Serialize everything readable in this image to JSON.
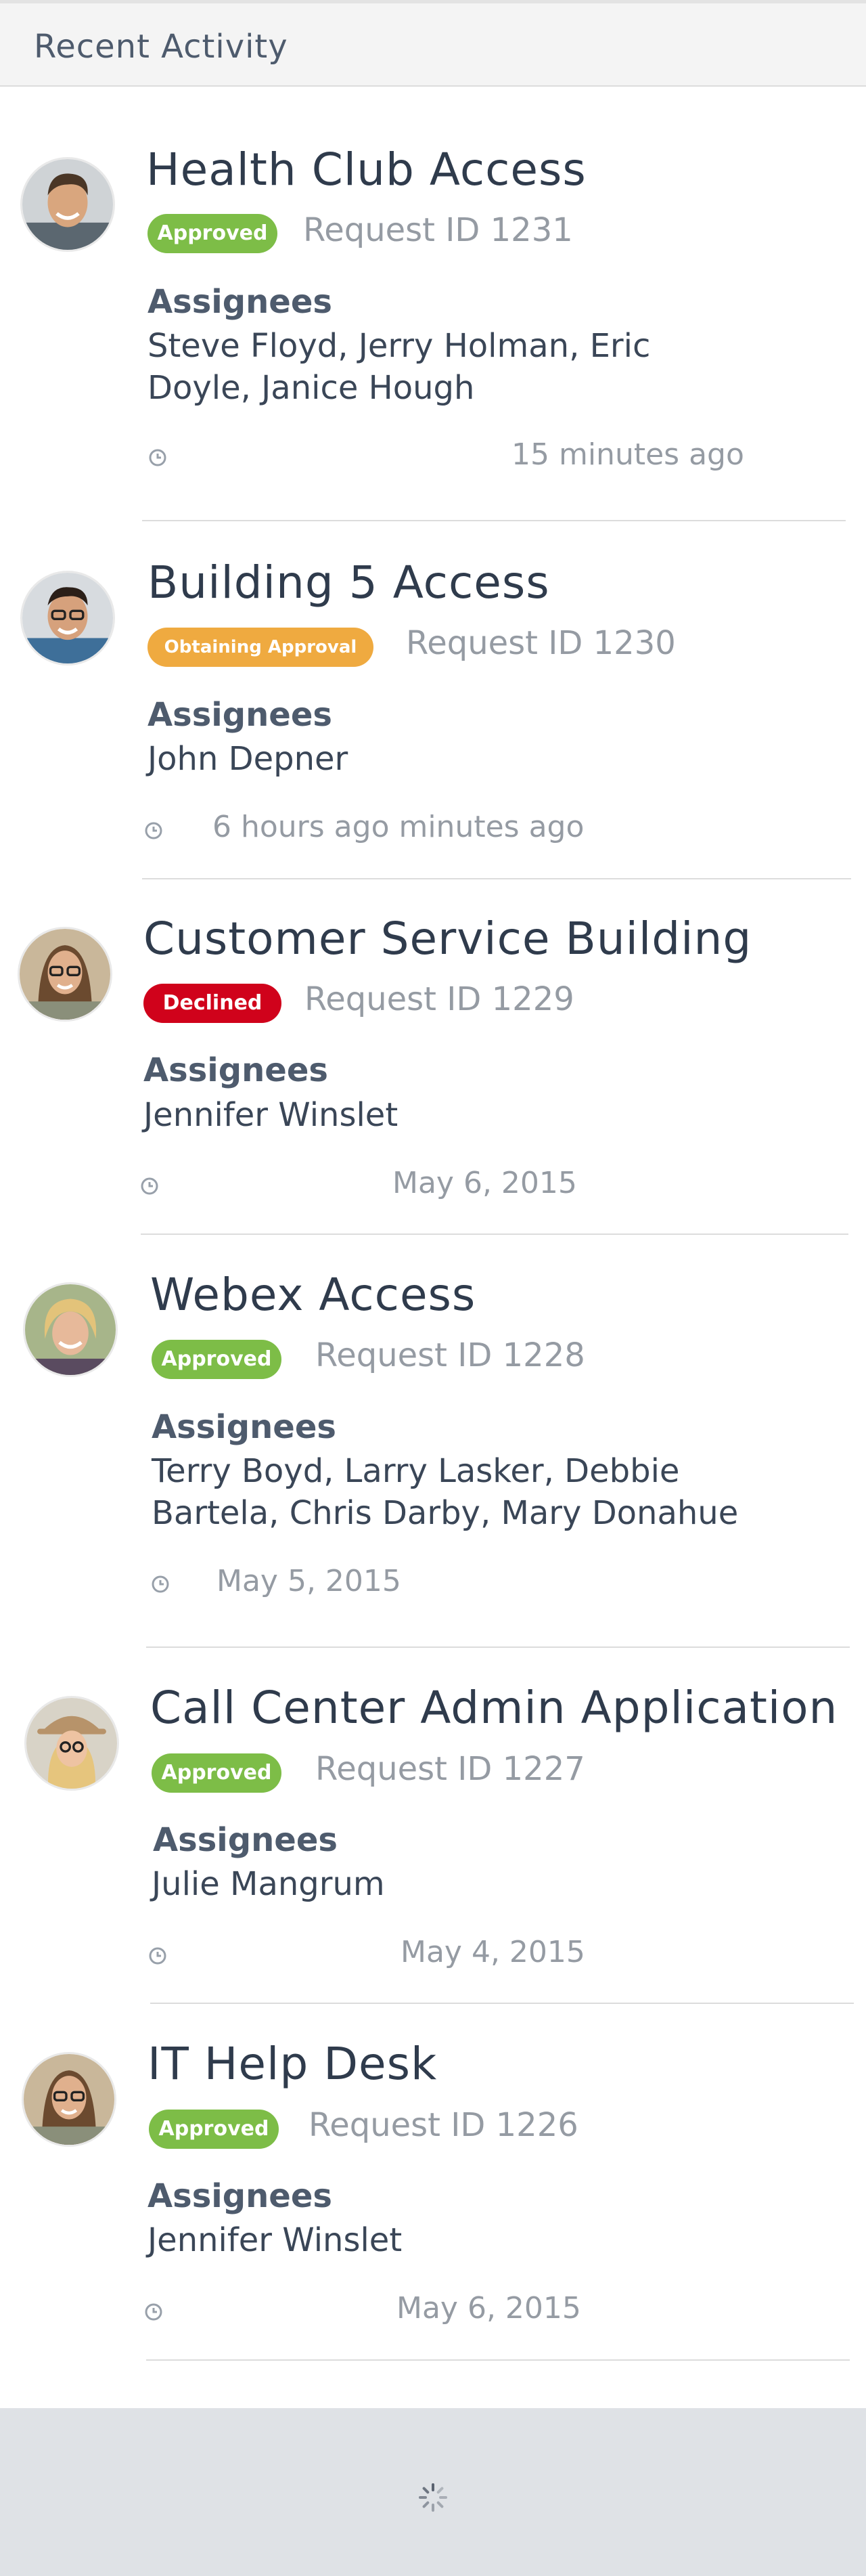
{
  "header": {
    "title": "Recent Activity"
  },
  "icons": {
    "clock": "clock-icon",
    "loading": "loading-spinner-icon"
  },
  "colors": {
    "approved": "#7dbd47",
    "obtaining_approval": "#efaa40",
    "declined": "#d0021b",
    "footer_bg": "#dfe2e6"
  },
  "assignees_label": "Assignees",
  "activities": [
    {
      "title": "Health Club Access",
      "status": "Approved",
      "request_id": "Request ID 1231",
      "assignees": "Steve Floyd, Jerry Holman, Eric Doyle, Janice Hough",
      "time": "15 minutes ago"
    },
    {
      "title": "Building 5 Access",
      "status": "Obtaining Approval",
      "request_id": "Request ID 1230",
      "assignees": "John Depner",
      "time": "6 hours ago minutes ago"
    },
    {
      "title": "Customer Service Building",
      "status": "Declined",
      "request_id": "Request ID 1229",
      "assignees": "Jennifer Winslet",
      "time": "May 6, 2015"
    },
    {
      "title": "Webex Access",
      "status": "Approved",
      "request_id": "Request ID 1228",
      "assignees": "Terry Boyd, Larry Lasker, Debbie Bartela, Chris Darby, Mary Donahue",
      "time": "May 5, 2015"
    },
    {
      "title": "Call Center Admin Application",
      "status": "Approved",
      "request_id": "Request ID 1227",
      "assignees": "Julie Mangrum",
      "time": "May 4, 2015"
    },
    {
      "title": "IT Help Desk",
      "status": "Approved",
      "request_id": "Request ID 1226",
      "assignees": "Jennifer Winslet",
      "time": "May 6, 2015"
    }
  ]
}
